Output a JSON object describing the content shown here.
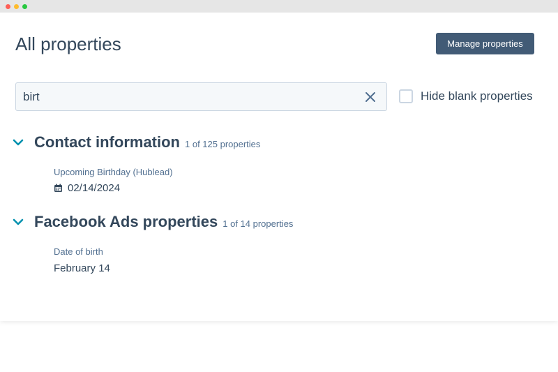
{
  "window": {
    "controls": [
      "close",
      "minimize",
      "maximize"
    ]
  },
  "page": {
    "title": "All properties",
    "manage_button": "Manage properties"
  },
  "search": {
    "value": "birt",
    "clear_icon": "close-icon"
  },
  "filter": {
    "hide_blank_label": "Hide blank properties",
    "checked": false
  },
  "sections": [
    {
      "title": "Contact information",
      "count": "1 of 125 properties",
      "expanded": true,
      "properties": [
        {
          "label": "Upcoming Birthday (Hublead)",
          "value": "02/14/2024",
          "icon": "calendar-icon"
        }
      ]
    },
    {
      "title": "Facebook Ads properties",
      "count": "1 of 14 properties",
      "expanded": true,
      "properties": [
        {
          "label": "Date of birth",
          "value": "February 14"
        }
      ]
    }
  ],
  "colors": {
    "primary_button": "#425b76",
    "text": "#33475b",
    "secondary_text": "#516f90",
    "chevron": "#0091ae",
    "input_bg": "#f5f8fa",
    "border": "#cbd6e2"
  }
}
